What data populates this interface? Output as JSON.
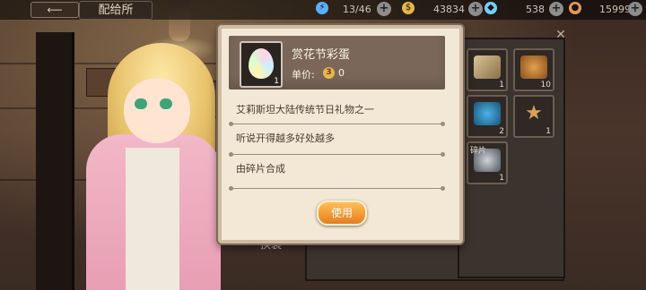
{
  "topbar": {
    "location_title": "配给所",
    "resources": [
      {
        "icon": "energy-icon",
        "value": "13/46",
        "color": "#5ab0ff"
      },
      {
        "icon": "gold-icon",
        "value": "43834",
        "color": "#e8b64a"
      },
      {
        "icon": "crystal-icon",
        "value": "538",
        "color": "#6fd0ff"
      },
      {
        "icon": "gem-icon",
        "value": "15999",
        "color": "#e39a5b"
      }
    ],
    "plus_label": "+"
  },
  "dialog": {
    "item_name": "赏花节彩蛋",
    "item_count": "1",
    "price_label": "单价:",
    "price_currency_glyph": "3",
    "price_value": "0",
    "descriptions": [
      "艾莉斯坦大陆传统节日礼物之一",
      "听说开得越多好处越多",
      "由碎片合成"
    ],
    "use_button": "使用"
  },
  "inventory": {
    "slots": [
      {
        "icon": "scroll-icon",
        "count": "1",
        "tag": ""
      },
      {
        "icon": "roast-chicken-icon",
        "count": "10",
        "tag": ""
      },
      {
        "icon": "potion-jar-icon",
        "count": "2",
        "tag": ""
      },
      {
        "icon": "starfish-icon",
        "count": "1",
        "tag": ""
      },
      {
        "icon": "bunny-fragment-icon",
        "count": "1",
        "tag": "碎片"
      }
    ]
  },
  "floor_label": "换装"
}
